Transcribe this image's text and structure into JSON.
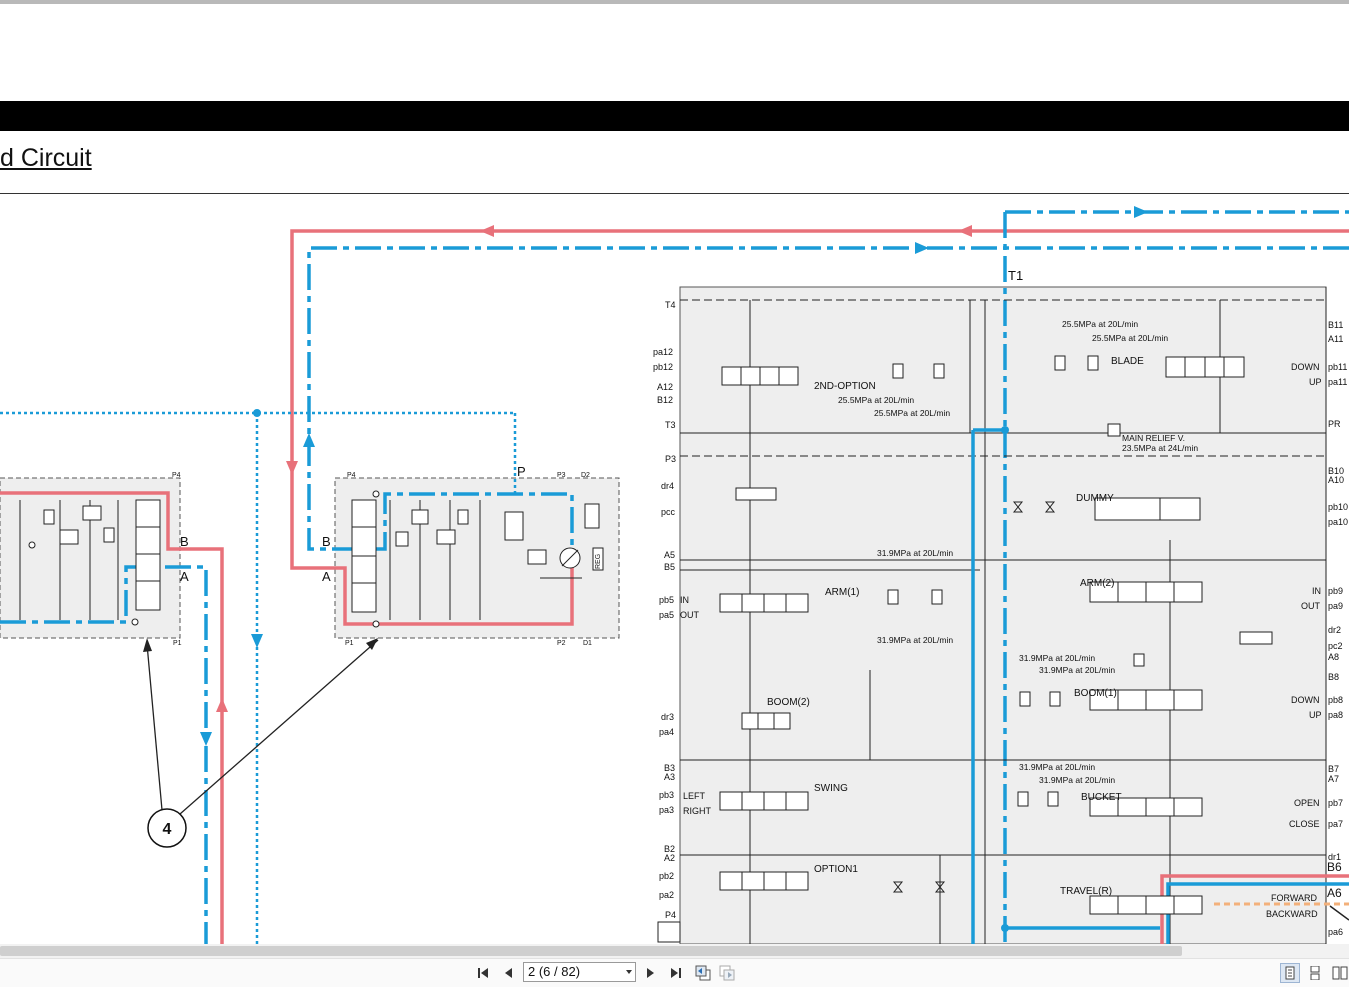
{
  "document": {
    "title_fragment": "d Circuit"
  },
  "schematic": {
    "left_valve": {
      "port_b": "B",
      "port_a": "A",
      "port_p4": "P4",
      "port_p1": "P1"
    },
    "mid_valve": {
      "port_b": "B",
      "port_a": "A",
      "port_p": "P",
      "port_p4": "P4",
      "port_p3": "P3",
      "port_d2": "D2",
      "port_p1": "P1",
      "port_p2": "P2",
      "port_d1": "D1",
      "reg_label": "REG"
    },
    "callout": "4",
    "block": {
      "t1": "T1",
      "left_ports": [
        "T4",
        "pa12",
        "pb12",
        "A12",
        "B12",
        "T3",
        "P3",
        "dr4",
        "pcc",
        "A5",
        "B5",
        "pb5",
        "pa5",
        "dr3",
        "pa4",
        "B3",
        "A3",
        "pb3",
        "pa3",
        "B2",
        "A2",
        "pb2",
        "pa2",
        "P4"
      ],
      "right_ports": [
        "B11",
        "A11",
        "pb11",
        "pa11",
        "PR",
        "B10",
        "A10",
        "pb10",
        "pa10",
        "pb9",
        "pa9",
        "dr2",
        "pc2",
        "A8",
        "B8",
        "pb8",
        "pa8",
        "B7",
        "A7",
        "pb7",
        "pa7",
        "dr1",
        "B6",
        "A6",
        "pa6"
      ],
      "sections": {
        "option2": "2ND-OPTION",
        "blade": "BLADE",
        "main_relief": "MAIN RELIEF V.",
        "main_relief_setting": "23.5MPa at 24L/min",
        "dummy": "DUMMY",
        "arm1": "ARM(1)",
        "arm2": "ARM(2)",
        "boom1": "BOOM(1)",
        "boom2": "BOOM(2)",
        "swing": "SWING",
        "bucket": "BUCKET",
        "option1": "OPTION1",
        "travel": "TRAVEL(R)"
      },
      "pressure_labels": {
        "p255_a": "25.5MPa at 20L/min",
        "p255_b": "25.5MPa at 20L/min",
        "p255_c": "25.5MPa at 20L/min",
        "p255_d": "25.5MPa at 20L/min",
        "p319_a": "31.9MPa at 20L/min",
        "p319_b": "31.9MPa at 20L/min",
        "p319_c": "31.9MPa at 20L/min",
        "p319_d": "31.9MPa at 20L/min",
        "p319_e": "31.9MPa at 20L/min",
        "p319_f": "31.9MPa at 20L/min"
      },
      "direction_labels": {
        "down11": "DOWN",
        "up11": "UP",
        "in9": "IN",
        "out9": "OUT",
        "down8": "DOWN",
        "up8": "UP",
        "open7": "OPEN",
        "close7": "CLOSE",
        "forward": "FORWARD",
        "backward": "BACKWARD",
        "in5": "IN",
        "out5": "OUT",
        "left3": "LEFT",
        "right3": "RIGHT"
      }
    },
    "colors": {
      "pressure_line": "#e8717a",
      "return_line": "#1a9bd7",
      "pilot_line": "#1a9bd7",
      "highlight_orange": "#f3b07a"
    }
  },
  "viewer": {
    "page_indicator": "2 (6 / 82)"
  }
}
